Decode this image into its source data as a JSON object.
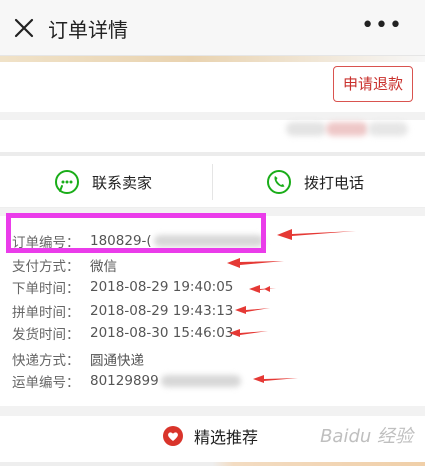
{
  "header": {
    "title": "订单详情",
    "more": "•••"
  },
  "actions": {
    "refund_label": "申请退款"
  },
  "contact": {
    "seller_label": "联系卖家",
    "phone_label": "拨打电话"
  },
  "details": [
    {
      "label": "订单编号：",
      "value": "180829-("
    },
    {
      "label": "支付方式：",
      "value": "微信"
    },
    {
      "label": "下单时间：",
      "value": "2018-08-29 19:40:05"
    },
    {
      "label": "拼单时间：",
      "value": "2018-08-29 19:43:13"
    },
    {
      "label": "发货时间：",
      "value": "2018-08-30 15:46:03"
    },
    {
      "label": "快递方式：",
      "value": "圆通快递"
    },
    {
      "label": "运单编号：",
      "value": "80129899"
    }
  ],
  "recommend": {
    "label": "精选推荐"
  },
  "watermark": "Baidu 经验",
  "colors": {
    "accent": "#c9302c",
    "highlight": "#ea3cea",
    "arrow": "#e53935",
    "wechat_green": "#1aad19"
  }
}
